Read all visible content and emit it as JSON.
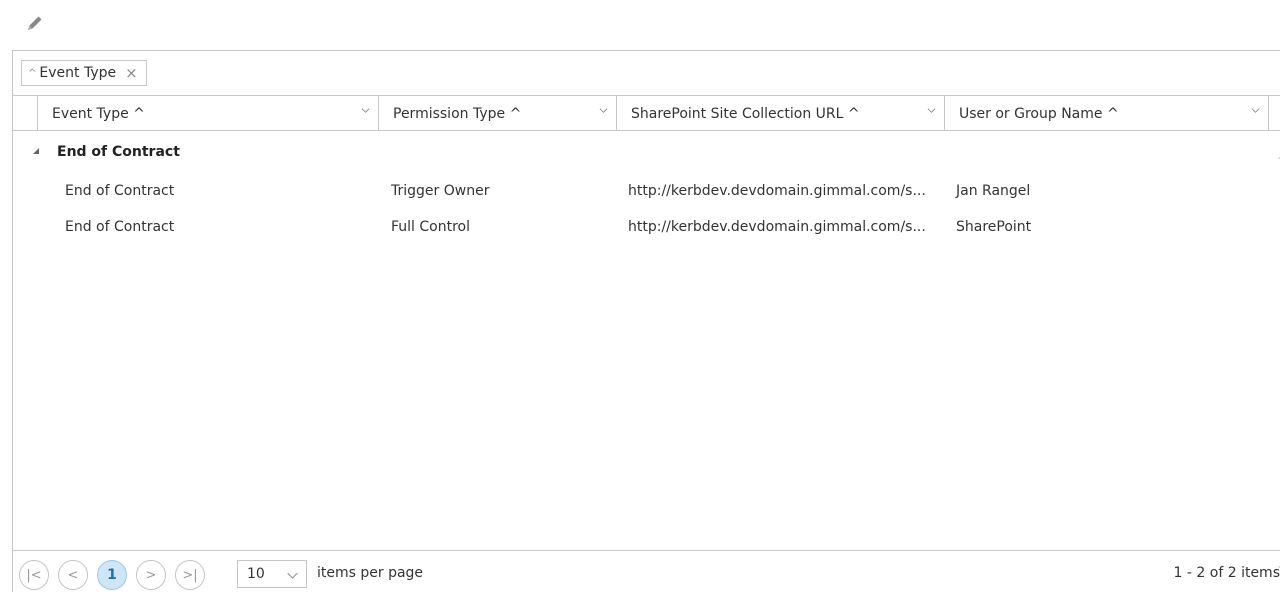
{
  "toolbar": {
    "edit_icon": "pencil-icon"
  },
  "group_panel": {
    "chip_label": "Event Type"
  },
  "columns": [
    {
      "label": "Event Type ^"
    },
    {
      "label": "Permission Type ^"
    },
    {
      "label": "SharePoint Site Collection URL ^"
    },
    {
      "label": "User or Group Name ^"
    }
  ],
  "group": {
    "label": "End of Contract"
  },
  "rows": [
    {
      "event_type": "End of Contract",
      "permission_type": "Trigger Owner",
      "site_url": "http://kerbdev.devdomain.gimmal.com/s...",
      "user": "Jan Rangel"
    },
    {
      "event_type": "End of Contract",
      "permission_type": "Full Control",
      "site_url": "http://kerbdev.devdomain.gimmal.com/s...",
      "user": "SharePoint"
    }
  ],
  "pager": {
    "first": "|<",
    "prev": "<",
    "current_page": "1",
    "next": ">",
    "last": ">|",
    "page_size": "10",
    "page_size_label": "items per page",
    "info": "1 - 2 of 2 items"
  }
}
